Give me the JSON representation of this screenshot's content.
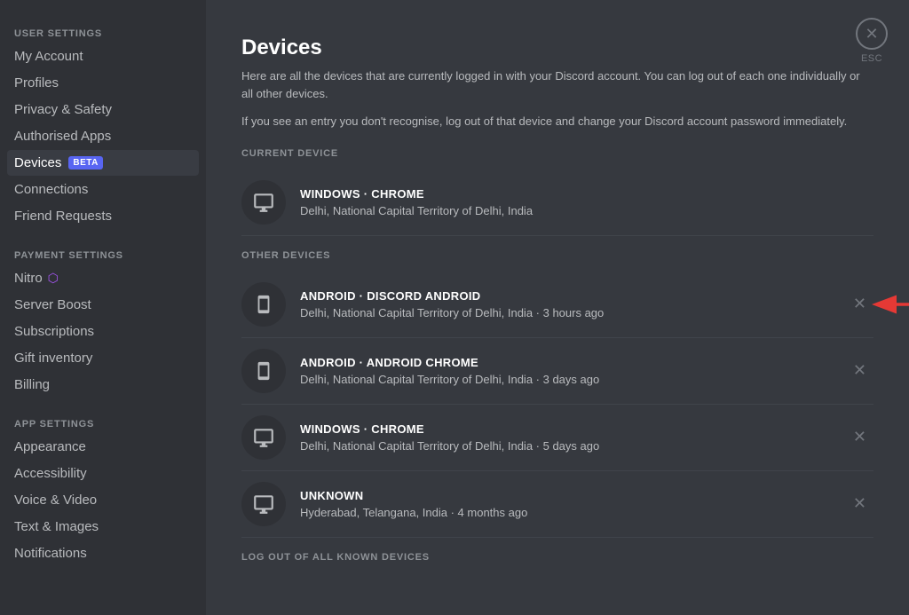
{
  "sidebar": {
    "user_settings_label": "USER SETTINGS",
    "payment_settings_label": "PAYMENT SETTINGS",
    "app_settings_label": "APP SETTINGS",
    "items": [
      {
        "id": "my-account",
        "label": "My Account",
        "active": false
      },
      {
        "id": "profiles",
        "label": "Profiles",
        "active": false
      },
      {
        "id": "privacy-safety",
        "label": "Privacy & Safety",
        "active": false
      },
      {
        "id": "authorised-apps",
        "label": "Authorised Apps",
        "active": false
      },
      {
        "id": "devices",
        "label": "Devices",
        "active": true,
        "badge": "BETA"
      },
      {
        "id": "connections",
        "label": "Connections",
        "active": false
      },
      {
        "id": "friend-requests",
        "label": "Friend Requests",
        "active": false
      }
    ],
    "payment_items": [
      {
        "id": "nitro",
        "label": "Nitro",
        "has_nitro_icon": true
      },
      {
        "id": "server-boost",
        "label": "Server Boost"
      },
      {
        "id": "subscriptions",
        "label": "Subscriptions"
      },
      {
        "id": "gift-inventory",
        "label": "Gift inventory"
      },
      {
        "id": "billing",
        "label": "Billing"
      }
    ],
    "app_items": [
      {
        "id": "appearance",
        "label": "Appearance"
      },
      {
        "id": "accessibility",
        "label": "Accessibility"
      },
      {
        "id": "voice-video",
        "label": "Voice & Video"
      },
      {
        "id": "text-images",
        "label": "Text & Images"
      },
      {
        "id": "notifications",
        "label": "Notifications"
      }
    ]
  },
  "main": {
    "title": "Devices",
    "description": "Here are all the devices that are currently logged in with your Discord account. You can log out of each one individually or all other devices.",
    "warning": "If you see an entry you don't recognise, log out of that device and change your Discord account password immediately.",
    "current_device_label": "CURRENT DEVICE",
    "other_devices_label": "OTHER DEVICES",
    "log_out_label": "LOG OUT OF ALL KNOWN DEVICES",
    "close_label": "ESC",
    "current_device": {
      "icon": "desktop",
      "name": "WINDOWS · CHROME",
      "location": "Delhi, National Capital Territory of Delhi, India"
    },
    "other_devices": [
      {
        "id": "device-1",
        "icon": "mobile",
        "name": "ANDROID · DISCORD ANDROID",
        "location": "Delhi, National Capital Territory of Delhi, India · 3 hours ago",
        "highlighted": true
      },
      {
        "id": "device-2",
        "icon": "mobile",
        "name": "ANDROID · ANDROID CHROME",
        "location": "Delhi, National Capital Territory of Delhi, India · 3 days ago",
        "highlighted": false
      },
      {
        "id": "device-3",
        "icon": "desktop",
        "name": "WINDOWS · CHROME",
        "location": "Delhi, National Capital Territory of Delhi, India · 5 days ago",
        "highlighted": false
      },
      {
        "id": "device-4",
        "icon": "desktop",
        "name": "UNKNOWN",
        "location": "Hyderabad, Telangana, India · 4 months ago",
        "highlighted": false
      }
    ]
  }
}
